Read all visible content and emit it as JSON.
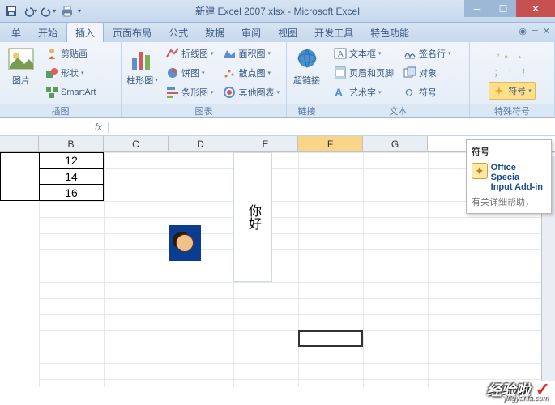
{
  "window": {
    "title": "新建 Excel 2007.xlsx - Microsoft Excel"
  },
  "tabs": {
    "items": [
      "单",
      "开始",
      "插入",
      "页面布局",
      "公式",
      "数据",
      "审阅",
      "视图",
      "开发工具",
      "特色功能"
    ],
    "active": "插入"
  },
  "ribbon": {
    "illustrations": {
      "label": "插图",
      "picture": "图片",
      "clipart": "剪贴画",
      "shapes": "形状",
      "smartart": "SmartArt"
    },
    "charts": {
      "label": "图表",
      "column": "柱形图",
      "line": "折线图",
      "area": "面积图",
      "pie": "饼图",
      "scatter": "散点图",
      "bar": "条形图",
      "other": "其他图表"
    },
    "links": {
      "label": "链接",
      "hyperlink": "超链接"
    },
    "text": {
      "label": "文本",
      "textbox": "文本框",
      "headerfooter": "页眉和页脚",
      "wordart": "艺术字",
      "sigline": "签名行",
      "object": "对象",
      "symbol": "符号"
    },
    "special": {
      "label": "特殊符号",
      "symbol_btn": "符号"
    }
  },
  "formula_bar": {
    "namebox": "",
    "fx": "fx",
    "value": ""
  },
  "columns": [
    "B",
    "C",
    "D",
    "E",
    "F",
    "G"
  ],
  "cells": {
    "b1": "12",
    "b2": "14",
    "b3": "16",
    "e_text": "你好"
  },
  "tooltip": {
    "title": "符号",
    "line1_bold": "Office Specia",
    "line2_bold": "Input Add-in",
    "help": "有关详细帮助，"
  },
  "watermark": {
    "text": "经验啦",
    "sub": "jingyanla.com"
  }
}
